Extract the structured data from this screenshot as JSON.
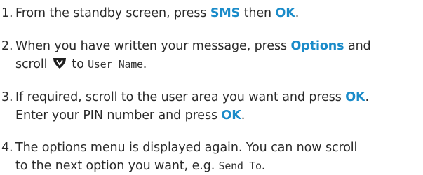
{
  "steps": [
    {
      "number": "1.",
      "text_1": "From the standby screen, press ",
      "key_1": "SMS",
      "text_2": " then ",
      "key_2": "OK",
      "text_3": "."
    },
    {
      "number": "2.",
      "text_1": "When you have written your message, press ",
      "key_1": "Options",
      "text_2": " and",
      "text_3": "scroll ",
      "icon": "navigation-key-icon",
      "text_4": " to ",
      "screen_text": "User Name",
      "text_5": "."
    },
    {
      "number": "3.",
      "text_1": "If required, scroll to the user area you want and press ",
      "key_1": "OK",
      "text_2": ".",
      "text_3": "Enter your PIN number and press ",
      "key_2": "OK",
      "text_4": "."
    },
    {
      "number": "4.",
      "text_1": "The options menu is displayed again. You can now scroll",
      "text_2": "to the next option you want, e.g. ",
      "screen_text": "Send To",
      "text_3": "."
    }
  ],
  "colors": {
    "key_text": "#1a8bc9",
    "body_text": "#2a2a2a",
    "icon_fill": "#1e1e1e"
  }
}
